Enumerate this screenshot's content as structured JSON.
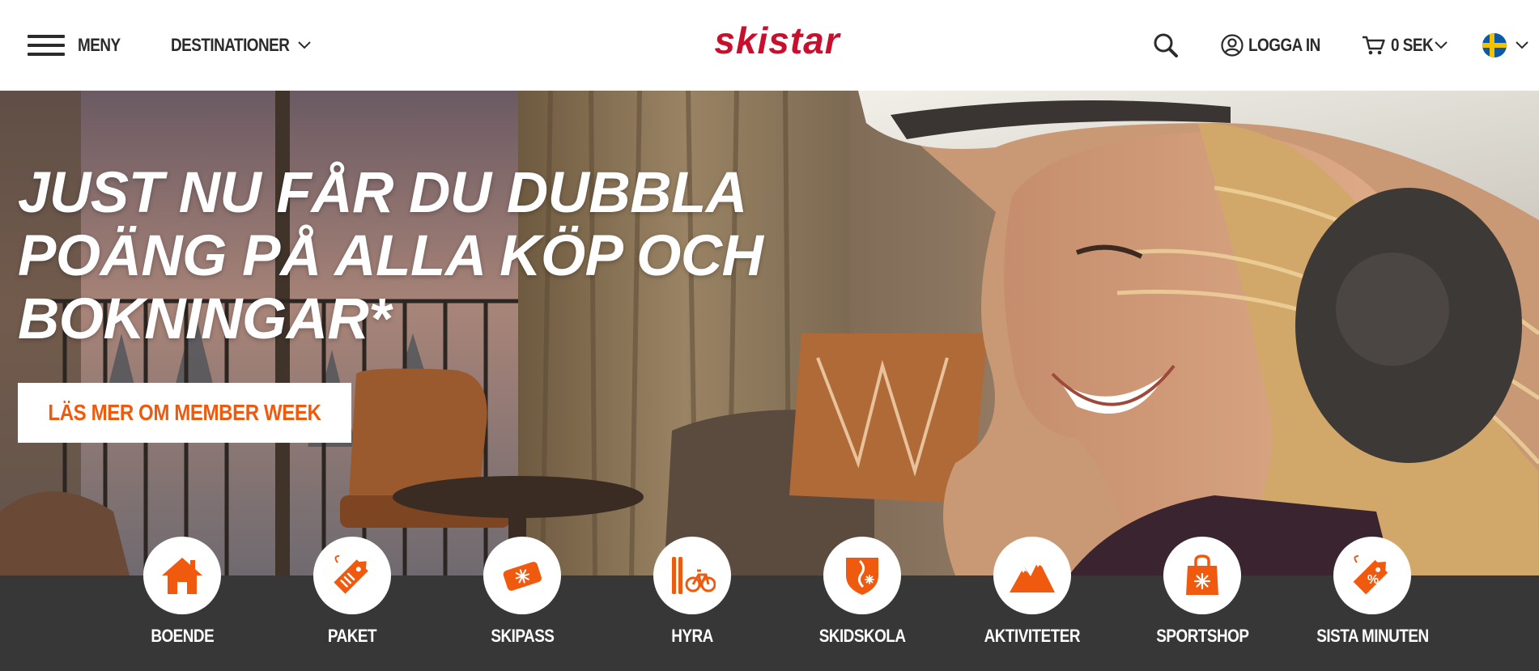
{
  "header": {
    "menu_label": "MENY",
    "destinations_label": "DESTINATIONER",
    "logo_text": "skistar",
    "login_label": "LOGGA IN",
    "cart_label": "0 SEK",
    "language_icon": "sweden-flag-icon"
  },
  "hero": {
    "title": "JUST NU FÅR DU DUBBLA POÄNG PÅ ALLA KÖP OCH BOKNINGAR*",
    "cta_label": "LÄS MER OM MEMBER WEEK"
  },
  "categories": [
    {
      "label": "BOENDE",
      "icon": "house-icon"
    },
    {
      "label": "PAKET",
      "icon": "package-tag-icon"
    },
    {
      "label": "SKIPASS",
      "icon": "skipass-icon"
    },
    {
      "label": "HYRA",
      "icon": "rental-icon"
    },
    {
      "label": "SKIDSKOLA",
      "icon": "ski-school-icon"
    },
    {
      "label": "AKTIVITETER",
      "icon": "mountains-icon"
    },
    {
      "label": "SPORTSHOP",
      "icon": "shopping-bag-icon"
    },
    {
      "label": "SISTA MINUTEN",
      "icon": "last-minute-tag-icon"
    }
  ],
  "colors": {
    "brand_red": "#c8102e",
    "accent_orange": "#f05a0f",
    "category_bar": "#373737",
    "header_text": "#2b2b2b"
  }
}
